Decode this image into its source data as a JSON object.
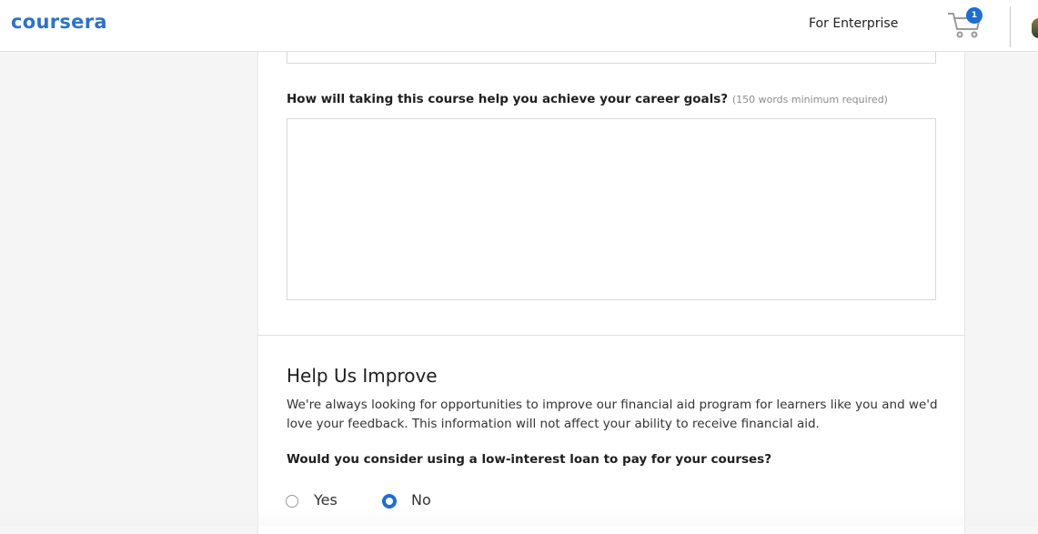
{
  "header": {
    "logo_text": "coursera",
    "enterprise_link": "For Enterprise",
    "cart_count": "1",
    "brand_color": "#2a73cc",
    "badge_color": "#1c6ed6"
  },
  "form": {
    "career_question": "How will taking this course help you achieve your career goals?",
    "career_hint": "(150 words minimum required)",
    "career_answer": ""
  },
  "improve": {
    "title": "Help Us Improve",
    "description": "We're always looking for opportunities to improve our financial aid program for learners like you and we'd love your feedback. This information will not affect your ability to receive financial aid.",
    "loan_question": "Would you consider using a low-interest loan to pay for your courses?",
    "options": [
      {
        "label": "Yes",
        "selected": false
      },
      {
        "label": "No",
        "selected": true
      }
    ]
  }
}
